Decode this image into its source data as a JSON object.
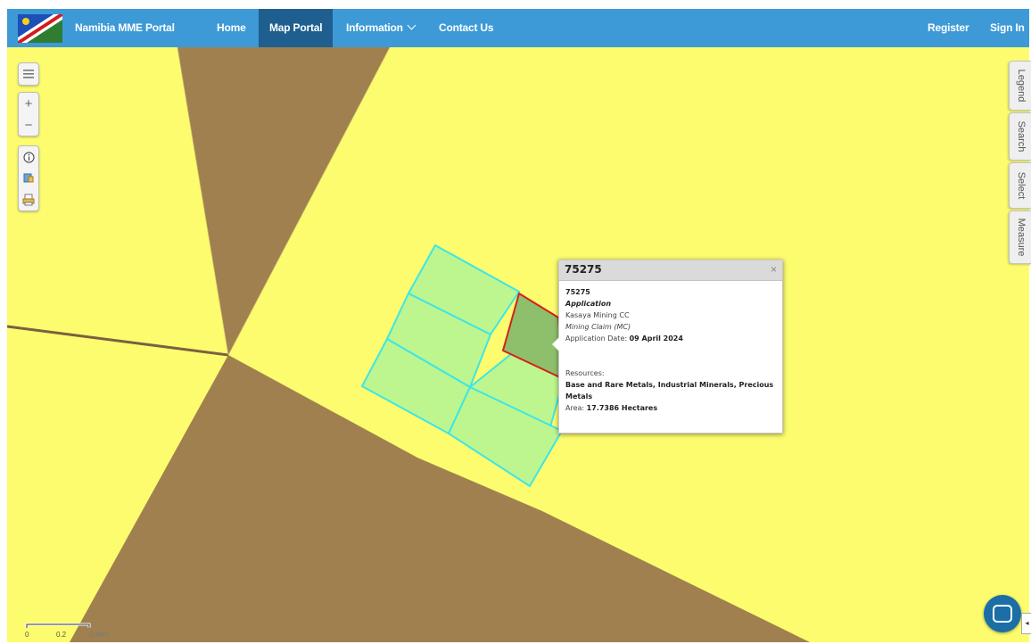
{
  "nav": {
    "brand": "Namibia MME Portal",
    "home": "Home",
    "map_portal": "Map Portal",
    "information": "Information",
    "contact": "Contact Us",
    "register": "Register",
    "sign_in": "Sign In",
    "active_tab": "Map Portal"
  },
  "toolbar": {
    "menu_icon": "menu-icon",
    "zoom_in": "+",
    "zoom_out": "−",
    "info_icon": "info-icon",
    "identify_icon": "identify-icon",
    "print_icon": "print-icon"
  },
  "side_tabs": {
    "legend": "Legend",
    "search": "Search",
    "select": "Select",
    "measure": "Measure"
  },
  "popup": {
    "title": "75275",
    "id": "75275",
    "status": "Application",
    "holder": "Kasaya Mining CC",
    "type": "Mining Claim (MC)",
    "application_date_label": "Application Date:",
    "application_date": "09 April 2024",
    "resources_label": "Resources:",
    "resources": "Base and Rare Metals, Industrial Minerals, Precious Metals",
    "area_label": "Area:",
    "area": "17.7386 Hectares",
    "close": "×"
  },
  "scale_bar": {
    "label_0": "0",
    "label_1": "0.2",
    "label_2": "0.4km"
  },
  "colors": {
    "nav_bg": "#3d9ad6",
    "nav_active": "#1f5f8f",
    "map_yellow": "#fcfc6e",
    "map_brown": "#a0804f",
    "claim_fill": "#bdf58f",
    "claim_border": "#3de6e6",
    "selected_fill": "#8ebf6a",
    "selected_border": "#d42020"
  }
}
